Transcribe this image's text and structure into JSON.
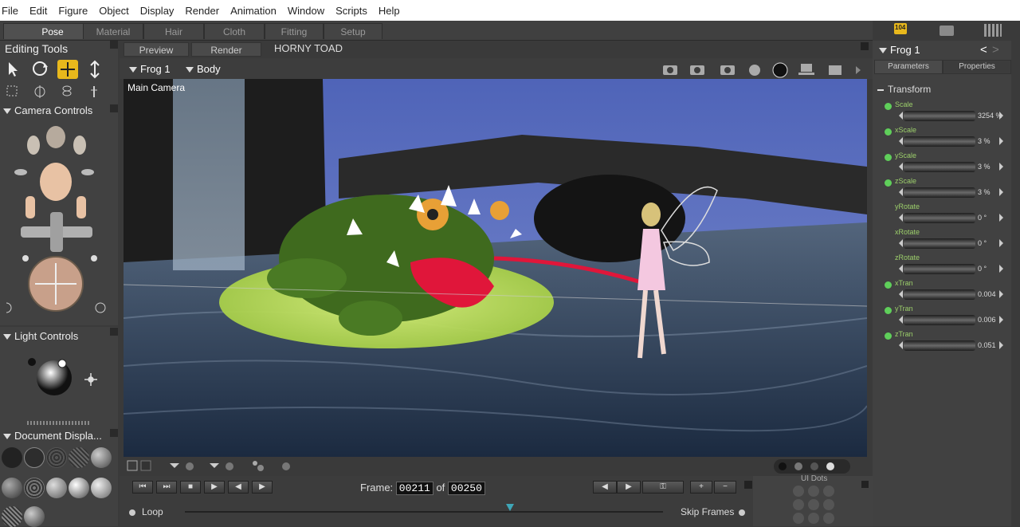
{
  "menu": [
    "File",
    "Edit",
    "Figure",
    "Object",
    "Display",
    "Render",
    "Animation",
    "Window",
    "Scripts",
    "Help"
  ],
  "rooms": [
    "Pose",
    "Material",
    "Hair",
    "Cloth",
    "Fitting",
    "Setup"
  ],
  "badge": "104",
  "editing_tools": {
    "title": "Editing Tools"
  },
  "camera_controls": {
    "title": "Camera Controls"
  },
  "light_controls": {
    "title": "Light Controls"
  },
  "document_display": {
    "title": "Document  Displa..."
  },
  "view_tabs": {
    "preview": "Preview",
    "render": "Render",
    "doc_title": "HORNY TOAD"
  },
  "figure_select": {
    "figure": "Frog 1",
    "part": "Body"
  },
  "viewport": {
    "camera_label": "Main Camera"
  },
  "playback": {
    "frame_label": "Frame:",
    "current_frame": "00211",
    "of_label": "of",
    "total_frames": "00250",
    "loop_label": "Loop",
    "skip_frames_label": "Skip Frames",
    "scrub_progress": 0.68,
    "ui_dots": "UI Dots"
  },
  "right_panel": {
    "figure_name": "Frog 1",
    "tabs": [
      "Parameters",
      "Properties"
    ],
    "group": "Transform",
    "params": [
      {
        "name": "Scale",
        "value": "3254 %",
        "dot": true
      },
      {
        "name": "xScale",
        "value": "3 %",
        "dot": true
      },
      {
        "name": "yScale",
        "value": "3 %",
        "dot": true
      },
      {
        "name": "zScale",
        "value": "3 %",
        "dot": true
      },
      {
        "name": "yRotate",
        "value": "0 °",
        "dot": false
      },
      {
        "name": "xRotate",
        "value": "0 °",
        "dot": false
      },
      {
        "name": "zRotate",
        "value": "0 °",
        "dot": false
      },
      {
        "name": "xTran",
        "value": "0.004",
        "dot": true
      },
      {
        "name": "yTran",
        "value": "0.006",
        "dot": true
      },
      {
        "name": "zTran",
        "value": "0.051",
        "dot": true
      }
    ]
  },
  "colors": {
    "accent_yellow": "#e8b81c",
    "param_green": "#5fcf5a",
    "water": "#3d5570",
    "tongue": "#e0163a",
    "frog": "#3f6a1e"
  }
}
